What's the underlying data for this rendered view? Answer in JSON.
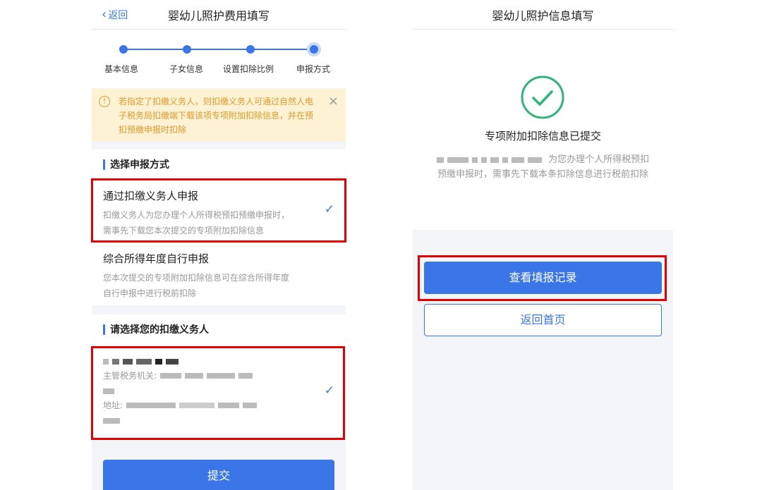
{
  "left": {
    "back_label": "返回",
    "title": "婴幼儿照护费用填写",
    "steps": [
      "基本信息",
      "子女信息",
      "设置扣除比例",
      "申报方式"
    ],
    "notice": "若指定了扣缴义务人，则扣缴义务人可通过自然人电子税务局扣缴端下载该项专项附加扣除信息，并在预扣预缴申报时扣除",
    "section1": "选择申报方式",
    "option1": {
      "title": "通过扣缴义务人申报",
      "desc": "扣缴义务人为您办理个人所得税预扣预缴申报时，需事先下载您本次提交的专项附加扣除信息"
    },
    "option2": {
      "title": "综合所得年度自行申报",
      "desc": "您本次提交的专项附加扣除信息可在综合所得年度自行申报中进行税前扣除"
    },
    "section2": "请选择您的扣缴义务人",
    "withholder": {
      "authority_label": "主管税务机关:",
      "address_label": "地址:"
    },
    "submit_label": "提交"
  },
  "right": {
    "title": "婴幼儿照护信息填写",
    "success_title": "专项附加扣除信息已提交",
    "success_desc": "为您办理个人所得税预扣预缴申报时，需事先下载本条扣除信息进行税前扣除",
    "view_records_label": "查看填报记录",
    "home_label": "返回首页"
  },
  "colors": {
    "accent": "#3a76e8",
    "highlight_box": "#e30000",
    "notice_bg": "#fdf2d4",
    "success_green": "#2fb47a"
  }
}
